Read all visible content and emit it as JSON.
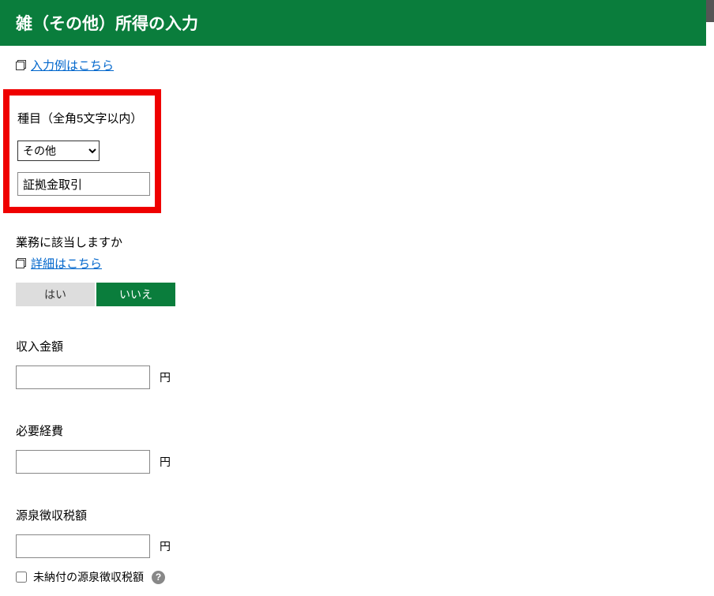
{
  "header": {
    "title": "雑（その他）所得の入力"
  },
  "links": {
    "examples": "入力例はこちら",
    "details": "詳細はこちら"
  },
  "categorySection": {
    "label": "種目（全角5文字以内）",
    "selectOptions": [
      "その他"
    ],
    "selectedOption": "その他",
    "textValue": "証拠金取引"
  },
  "businessQuestion": {
    "label": "業務に該当しますか",
    "yesLabel": "はい",
    "noLabel": "いいえ",
    "selected": "no"
  },
  "incomeAmount": {
    "label": "収入金額",
    "value": "",
    "unit": "円"
  },
  "expenses": {
    "label": "必要経費",
    "value": "",
    "unit": "円"
  },
  "withholding": {
    "label": "源泉徴収税額",
    "value": "",
    "unit": "円",
    "unpaidLabel": "未納付の源泉徴収税額",
    "unpaidChecked": false
  }
}
